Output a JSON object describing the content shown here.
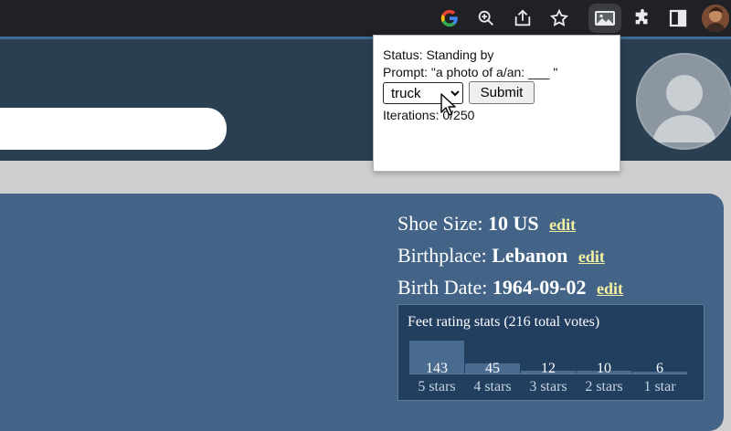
{
  "browser": {
    "toolbar_icons": [
      "google-icon",
      "zoom-icon",
      "share-icon",
      "bookmark-star-icon",
      "extension-icon",
      "puzzle-icon",
      "sidepanel-icon",
      "profile-avatar"
    ],
    "colors": {
      "toolbar_bg": "#202124"
    }
  },
  "page": {
    "profile": {
      "shoe_size_label": "Shoe Size:",
      "shoe_size_value": "10 US",
      "birthplace_label": "Birthplace:",
      "birthplace_value": "Lebanon",
      "birth_date_label": "Birth Date:",
      "birth_date_value": "1964-09-02",
      "edit_label": "edit"
    },
    "stats": {
      "title": "Feet rating stats (216 total votes)",
      "bars": [
        {
          "count": "143",
          "label": "5 stars",
          "fraction": 1.0
        },
        {
          "count": "45",
          "label": "4 stars",
          "fraction": 0.315
        },
        {
          "count": "12",
          "label": "3 stars",
          "fraction": 0.084
        },
        {
          "count": "10",
          "label": "2 stars",
          "fraction": 0.07
        },
        {
          "count": "6",
          "label": "1 star",
          "fraction": 0.042
        }
      ]
    },
    "colors": {
      "header_bg": "#2b3f52",
      "card_bg": "#436487",
      "edit_link": "#f4f0a2"
    }
  },
  "popup": {
    "status": "Status: Standing by",
    "prompt": "Prompt: \"a photo of a/an: ___ \"",
    "selected_class": "truck",
    "submit_label": "Submit",
    "iterations": "Iterations: 0/250"
  }
}
